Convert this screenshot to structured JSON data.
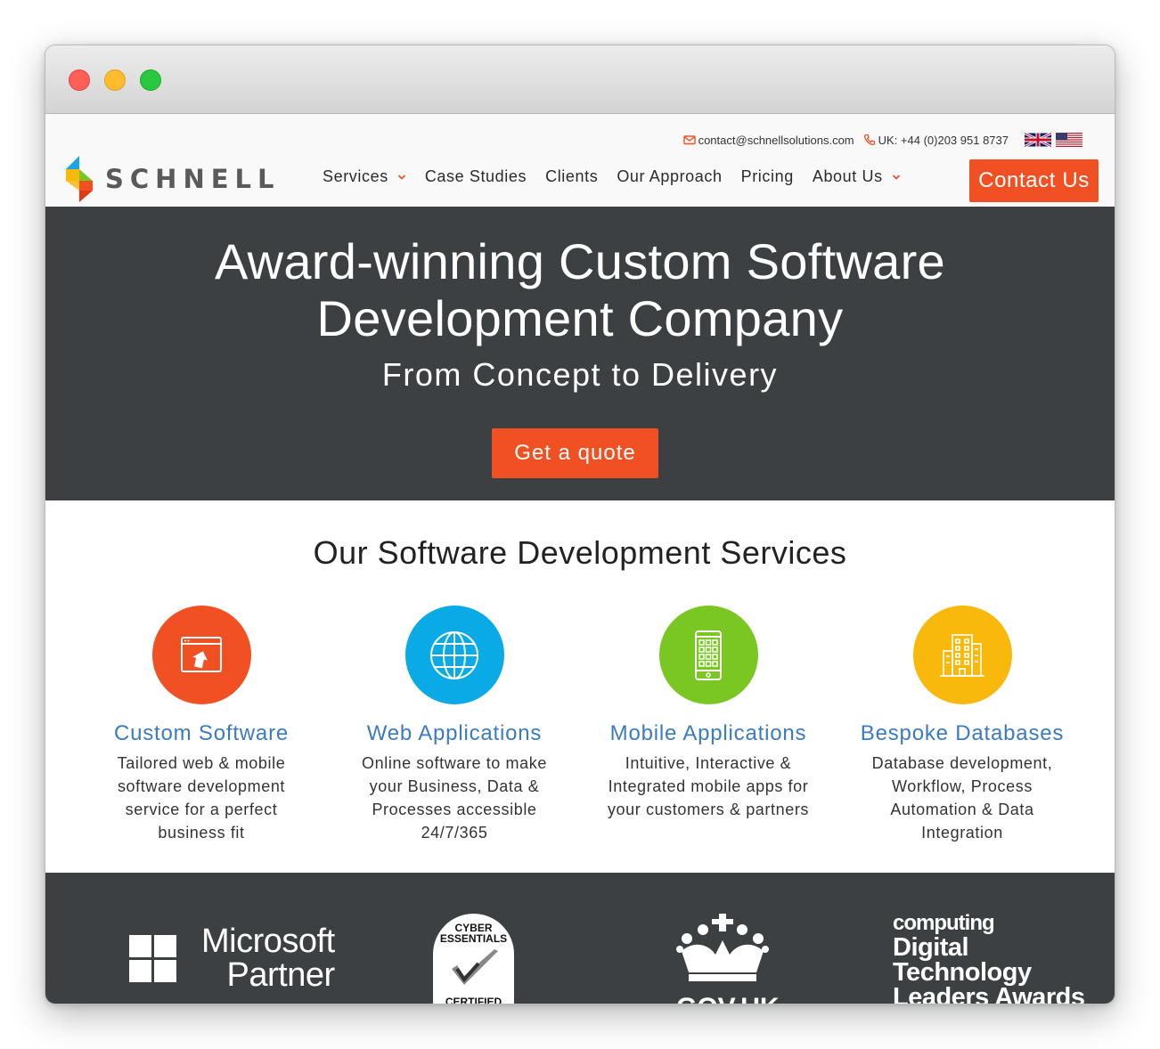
{
  "window": {
    "controls": [
      "close",
      "minimize",
      "maximize"
    ]
  },
  "topbar": {
    "email": "contact@schnellsolutions.com",
    "phone": "UK: +44 (0)203 951 8737",
    "flags": [
      "uk-flag",
      "us-flag"
    ]
  },
  "logo": {
    "text": "SCHNELL"
  },
  "nav": {
    "items": [
      {
        "label": "Services",
        "has_dropdown": true
      },
      {
        "label": "Case Studies",
        "has_dropdown": false
      },
      {
        "label": "Clients",
        "has_dropdown": false
      },
      {
        "label": "Our Approach",
        "has_dropdown": false
      },
      {
        "label": "Pricing",
        "has_dropdown": false
      },
      {
        "label": "About Us",
        "has_dropdown": true
      }
    ],
    "cta": "Contact Us"
  },
  "hero": {
    "title_line1": "Award-winning Custom Software",
    "title_line2": "Development Company",
    "subtitle": "From Concept to Delivery",
    "button": "Get a quote"
  },
  "services": {
    "heading": "Our Software Development Services",
    "cards": [
      {
        "title": "Custom Software",
        "desc": "Tailored web & mobile software development service for a perfect business fit",
        "color": "#f15022",
        "icon": "browser-upload-icon"
      },
      {
        "title": "Web Applications",
        "desc": "Online software to make your Business, Data & Processes accessible 24/7/365",
        "color": "#0aaae6",
        "icon": "globe-icon"
      },
      {
        "title": "Mobile Applications",
        "desc": "Intuitive, Interactive & Integrated mobile apps for your customers & partners",
        "color": "#7ac723",
        "icon": "mobile-phone-icon"
      },
      {
        "title": "Bespoke Databases",
        "desc": "Database development, Workflow, Process Automation & Data Integration",
        "color": "#f8b80c",
        "icon": "buildings-icon"
      }
    ]
  },
  "partners": {
    "microsoft_line1": "Microsoft",
    "microsoft_line2": "Partner",
    "cyber_line1": "CYBER",
    "cyber_line2": "ESSENTIALS",
    "cyber_line3": "CERTIFIED",
    "gov": "GOV.UK",
    "computing_line1": "computing",
    "computing_line2": "Digital",
    "computing_line3": "Technology",
    "computing_line4": "Leaders Awards"
  }
}
